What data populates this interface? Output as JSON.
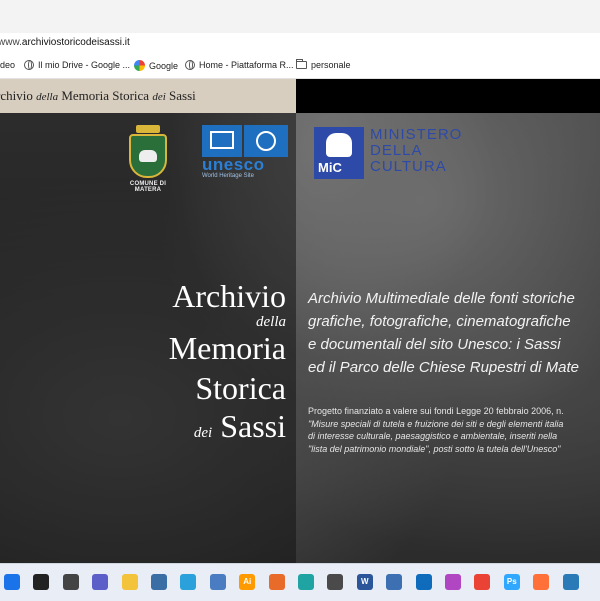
{
  "browser": {
    "address": {
      "prefix": "www.",
      "host": "archiviostoricodeisassi.it"
    },
    "bookmarks": [
      {
        "label": "ideo",
        "icon": "video-icon"
      },
      {
        "label": "Il mio Drive - Google ...",
        "icon": "globe-icon"
      },
      {
        "label": "Google",
        "icon": "google-icon"
      },
      {
        "label": "Home - Piattaforma R...",
        "icon": "globe-icon"
      },
      {
        "label": "personale",
        "icon": "folder-icon"
      }
    ]
  },
  "site": {
    "header_parts": [
      "rchivio ",
      "della",
      " Memoria Storica ",
      "dei",
      " Sassi"
    ],
    "logos": {
      "matera": "COMUNE DI MATERA",
      "unesco_word": "unesco",
      "unesco_sub": "World Heritage Site",
      "mic_badge": "MiC",
      "mic_lines": [
        "MINISTERO",
        "DELLA",
        "CULTURA"
      ]
    },
    "title": {
      "l1": "Archivio",
      "l2": "della",
      "l3": "Memoria",
      "l4": "Storica",
      "l5a": "dei",
      "l5b": "Sassi"
    },
    "description": [
      "Archivio Multimediale delle fonti storiche",
      "grafiche, fotografiche, cinematografiche",
      "e documentali del sito Unesco: i Sassi",
      "ed il Parco delle Chiese Rupestri di Mate"
    ],
    "note": [
      "Progetto finanziato a valere sui fondi Legge 20 febbraio 2006, n.",
      "\"Misure speciali di tutela e fruizione dei siti e degli elementi italia",
      "di interesse culturale, paesaggistico e ambientale, inseriti nella",
      "\"lista del patrimonio mondiale\", posti sotto la tutela dell'Unesco\""
    ]
  },
  "taskbar": {
    "icons": [
      "windows-start-icon",
      "search-icon",
      "task-view-icon",
      "chat-icon",
      "file-explorer-icon",
      "settings-icon",
      "telegram-icon",
      "notepad-icon",
      "illustrator-icon",
      "app-icon",
      "edge-icon",
      "cloud-icon",
      "word-icon",
      "calculator-icon",
      "outlook-icon",
      "paint-icon",
      "chrome-icon",
      "photoshop-icon",
      "firefox-icon",
      "extra-app-icon"
    ],
    "colors": [
      "#1a73e8",
      "#222222",
      "#444444",
      "#5b5fc7",
      "#f3c33b",
      "#3a6ea5",
      "#2aa1da",
      "#4a7cc2",
      "#ff9a00",
      "#e86b2a",
      "#1fa3a3",
      "#4a4a4a",
      "#2b579a",
      "#3d6fb3",
      "#0f6cbd",
      "#b146c2",
      "#ea4335",
      "#31a8ff",
      "#ff7139",
      "#2a7ab8"
    ],
    "labels": [
      "",
      "",
      "",
      "",
      "",
      "",
      "",
      "",
      "Ai",
      "",
      "",
      "",
      "W",
      "",
      "",
      "",
      "",
      "Ps",
      "",
      ""
    ]
  }
}
